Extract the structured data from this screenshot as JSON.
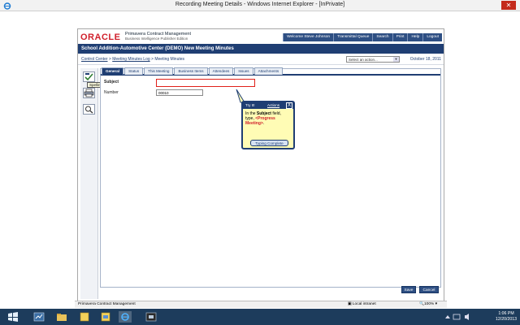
{
  "window": {
    "title": "Recording Meeting Details - Windows Internet Explorer - [InPrivate]"
  },
  "brand": {
    "logo": "ORACLE",
    "product": "Primavera Contract Management",
    "edition": "Business Intelligence Publisher Edition"
  },
  "toplinks": [
    "Welcome Steve Johnson",
    "Transmittal Queue",
    "Search",
    "Print",
    "Help",
    "Logout"
  ],
  "project_title": "School Addition-Automotive Center (DEMO)  New Meeting Minutes",
  "breadcrumb": {
    "item1": "Control Center",
    "sep1": " > ",
    "item2": "Meeting Minutes Log",
    "sep2": " > ",
    "item3": "Meeting Minutes"
  },
  "action_select": {
    "value": "Select an action..."
  },
  "date": "October 18, 2011",
  "tooltip": "Spelling",
  "tabs": [
    "General",
    "Status",
    "This Meeting",
    "Business Items",
    "Attendees",
    "Issues",
    "Attachments"
  ],
  "form": {
    "subject_label": "Subject",
    "subject_value": "",
    "number_label": "Number",
    "number_value": "00010"
  },
  "callout": {
    "title": "Try It!",
    "actions": "Actions",
    "close": "X",
    "line1_pre": "In the ",
    "line1_bold": "Subject",
    "line1_post": " field,",
    "line2": "type, ",
    "line2_red": "<Progress Meeting>",
    "line2_end": ".",
    "button": "Typing Complete"
  },
  "buttons": {
    "save": "Save",
    "cancel": "Cancel"
  },
  "statusbar": {
    "left": "Primavera Contract Management",
    "zone": "Local intranet",
    "zoom": "100%"
  },
  "clock": {
    "time": "1:06 PM",
    "date": "12/20/2013"
  },
  "colors": {
    "navy": "#1f3e73",
    "oracle_red": "#d01f2b",
    "callout_bg": "#fffcb5"
  }
}
